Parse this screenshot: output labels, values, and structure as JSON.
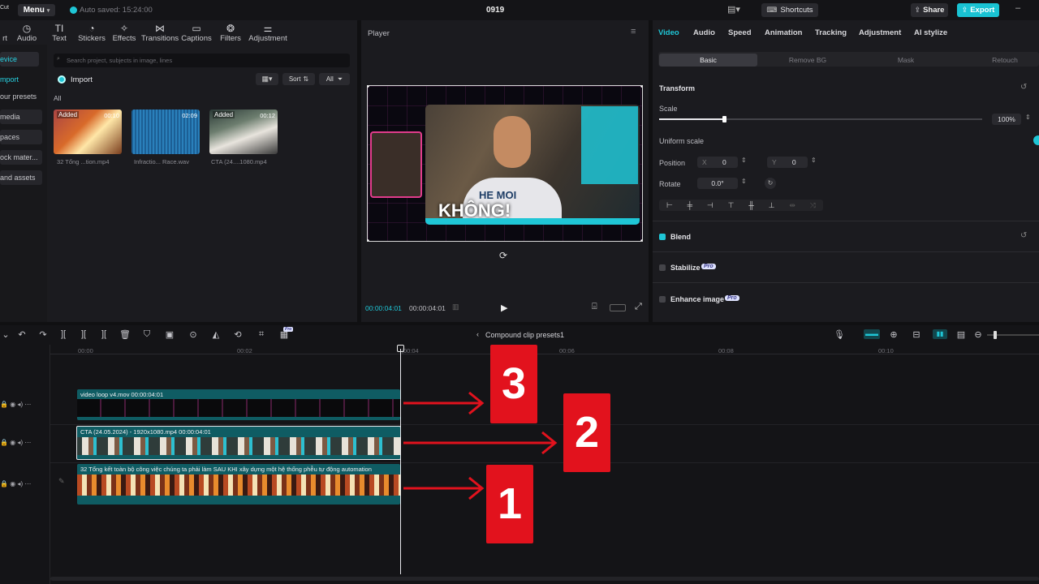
{
  "topbar": {
    "app_fragment": "Cut",
    "menu_label": "Menu",
    "autosave": "Auto saved: 15:24:00",
    "project_title": "0919",
    "shortcuts_label": "Shortcuts",
    "share_label": "Share",
    "export_label": "Export"
  },
  "media_tools": [
    {
      "label": "rt",
      "icon": "import-icon"
    },
    {
      "label": "Audio",
      "icon": "audio-icon"
    },
    {
      "label": "Text",
      "icon": "text-icon"
    },
    {
      "label": "Stickers",
      "icon": "sticker-icon"
    },
    {
      "label": "Effects",
      "icon": "effects-icon"
    },
    {
      "label": "Transitions",
      "icon": "transitions-icon"
    },
    {
      "label": "Captions",
      "icon": "captions-icon"
    },
    {
      "label": "Filters",
      "icon": "filters-icon"
    },
    {
      "label": "Adjustment",
      "icon": "adjustment-icon"
    }
  ],
  "sidebar": {
    "items": [
      {
        "label": "evice"
      },
      {
        "label": "mport"
      },
      {
        "label": "our presets"
      },
      {
        "label": "media"
      },
      {
        "label": "paces"
      },
      {
        "label": "ock mater..."
      },
      {
        "label": "and assets"
      }
    ]
  },
  "media": {
    "search_placeholder": "Search project, subjects in image, lines",
    "import_label": "Import",
    "sort_label": "Sort",
    "all_filter_label": "All",
    "section_label": "All",
    "items": [
      {
        "badge": "Added",
        "duration": "00:10",
        "name": "32 Tổng ...tion.mp4"
      },
      {
        "badge": "",
        "duration": "02:09",
        "name": "Infractio... Race.wav"
      },
      {
        "badge": "Added",
        "duration": "00:12",
        "name": "CTA (24....1080.mp4"
      }
    ]
  },
  "player": {
    "title": "Player",
    "overlay_text": "KHÔNG!",
    "shirt_text": "HE MOI",
    "current_time": "00:00:04:01",
    "total_time": "00:00:04:01"
  },
  "props": {
    "tabs": [
      "Video",
      "Audio",
      "Speed",
      "Animation",
      "Tracking",
      "Adjustment",
      "AI stylize"
    ],
    "subtabs": [
      "Basic",
      "Remove BG",
      "Mask",
      "Retouch"
    ],
    "transform_label": "Transform",
    "scale_label": "Scale",
    "scale_value": "100%",
    "scale_fraction": 0.2,
    "uniform_scale_label": "Uniform scale",
    "position_label": "Position",
    "pos_x_label": "X",
    "pos_x_value": "0",
    "pos_y_label": "Y",
    "pos_y_value": "0",
    "rotate_label": "Rotate",
    "rotate_value": "0.0°",
    "blend_label": "Blend",
    "stabilize_label": "Stabilize",
    "enhance_label": "Enhance image",
    "pro_badge": "Pro"
  },
  "timeline": {
    "compound_label": "Compound clip presets1",
    "ruler": [
      "00:00",
      "00:02",
      "|00:04",
      "00:06",
      "00:08",
      "00:10"
    ],
    "clips": [
      {
        "label": "video loop v4.mov  00:00:04:01"
      },
      {
        "label": "CTA (24.05.2024) - 1920x1080.mp4  00:00:04:01"
      },
      {
        "label": "32 Tổng kết toàn bộ công việc chúng ta phải làm SAU KHI xây dựng một hệ thống phễu tự động automation"
      }
    ],
    "callouts": [
      "3",
      "2",
      "1"
    ]
  },
  "colors": {
    "accent": "#1fc6d6",
    "export_bg": "#19c3d3",
    "callout_red": "#e2121d",
    "clip_teal": "#0f5c63"
  }
}
